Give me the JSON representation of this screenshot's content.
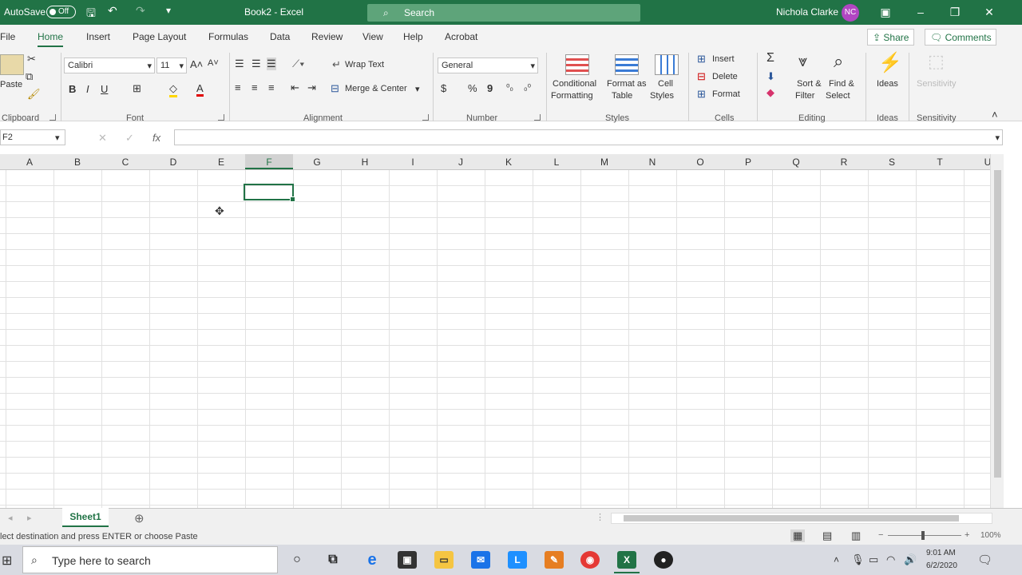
{
  "titlebar": {
    "autosave_label": "AutoSave",
    "autosave_state": "Off",
    "doc_title": "Book2 - Excel",
    "search_placeholder": "Search",
    "user_name": "Nichola Clarke",
    "user_initials": "NC"
  },
  "ribbon_tabs": [
    "File",
    "Home",
    "Insert",
    "Page Layout",
    "Formulas",
    "Data",
    "Review",
    "View",
    "Help",
    "Acrobat"
  ],
  "active_tab": "Home",
  "share_label": "Share",
  "comments_label": "Comments",
  "ribbon": {
    "clipboard": {
      "paste_label": "Paste",
      "group_label": "Clipboard"
    },
    "font": {
      "font_name": "Calibri",
      "font_size": "11",
      "bold": "B",
      "italic": "I",
      "underline": "U",
      "group_label": "Font"
    },
    "alignment": {
      "wrap_text": "Wrap Text",
      "merge_center": "Merge & Center",
      "group_label": "Alignment"
    },
    "number": {
      "format": "General",
      "currency": "$",
      "percent": "%",
      "comma": "9",
      "group_label": "Number"
    },
    "styles": {
      "conditional_formatting": [
        "Conditional",
        "Formatting"
      ],
      "format_as_table": [
        "Format as",
        "Table"
      ],
      "cell_styles": [
        "Cell",
        "Styles"
      ],
      "group_label": "Styles"
    },
    "cells": {
      "insert": "Insert",
      "delete": "Delete",
      "format": "Format",
      "group_label": "Cells"
    },
    "editing": {
      "sum": "Σ",
      "sort_filter": [
        "Sort &",
        "Filter"
      ],
      "find_select": [
        "Find &",
        "Select"
      ],
      "group_label": "Editing"
    },
    "ideas": {
      "label": "Ideas",
      "group_label": "Ideas"
    },
    "sensitivity": {
      "label": "Sensitivity",
      "group_label": "Sensitivity"
    }
  },
  "formula_bar": {
    "name_box": "F2",
    "fx_label": "fx",
    "value": ""
  },
  "columns": [
    "A",
    "B",
    "C",
    "D",
    "E",
    "F",
    "G",
    "H",
    "I",
    "J",
    "K",
    "L",
    "M",
    "N",
    "O",
    "P",
    "Q",
    "R",
    "S",
    "T",
    "U"
  ],
  "selected_column": "F",
  "sheets": [
    "Sheet1"
  ],
  "status_text": "lect destination and press ENTER or choose Paste",
  "zoom": "100%",
  "taskbar": {
    "search_placeholder": "Type here to search",
    "time": "9:01 AM",
    "date": "6/2/2020"
  },
  "colors": {
    "excel_green": "#217346",
    "avatar": "#b146c2"
  }
}
